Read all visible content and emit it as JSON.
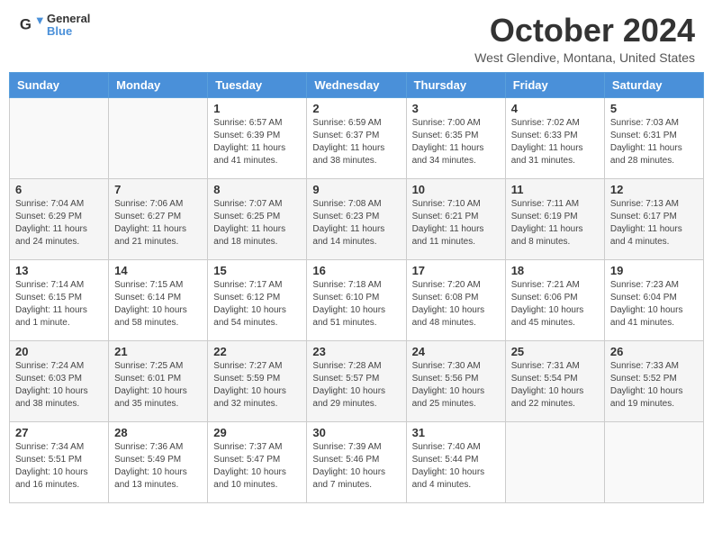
{
  "header": {
    "logo_line1": "General",
    "logo_line2": "Blue",
    "month_title": "October 2024",
    "subtitle": "West Glendive, Montana, United States"
  },
  "days_of_week": [
    "Sunday",
    "Monday",
    "Tuesday",
    "Wednesday",
    "Thursday",
    "Friday",
    "Saturday"
  ],
  "weeks": [
    [
      {
        "day": "",
        "info": ""
      },
      {
        "day": "",
        "info": ""
      },
      {
        "day": "1",
        "info": "Sunrise: 6:57 AM\nSunset: 6:39 PM\nDaylight: 11 hours and 41 minutes."
      },
      {
        "day": "2",
        "info": "Sunrise: 6:59 AM\nSunset: 6:37 PM\nDaylight: 11 hours and 38 minutes."
      },
      {
        "day": "3",
        "info": "Sunrise: 7:00 AM\nSunset: 6:35 PM\nDaylight: 11 hours and 34 minutes."
      },
      {
        "day": "4",
        "info": "Sunrise: 7:02 AM\nSunset: 6:33 PM\nDaylight: 11 hours and 31 minutes."
      },
      {
        "day": "5",
        "info": "Sunrise: 7:03 AM\nSunset: 6:31 PM\nDaylight: 11 hours and 28 minutes."
      }
    ],
    [
      {
        "day": "6",
        "info": "Sunrise: 7:04 AM\nSunset: 6:29 PM\nDaylight: 11 hours and 24 minutes."
      },
      {
        "day": "7",
        "info": "Sunrise: 7:06 AM\nSunset: 6:27 PM\nDaylight: 11 hours and 21 minutes."
      },
      {
        "day": "8",
        "info": "Sunrise: 7:07 AM\nSunset: 6:25 PM\nDaylight: 11 hours and 18 minutes."
      },
      {
        "day": "9",
        "info": "Sunrise: 7:08 AM\nSunset: 6:23 PM\nDaylight: 11 hours and 14 minutes."
      },
      {
        "day": "10",
        "info": "Sunrise: 7:10 AM\nSunset: 6:21 PM\nDaylight: 11 hours and 11 minutes."
      },
      {
        "day": "11",
        "info": "Sunrise: 7:11 AM\nSunset: 6:19 PM\nDaylight: 11 hours and 8 minutes."
      },
      {
        "day": "12",
        "info": "Sunrise: 7:13 AM\nSunset: 6:17 PM\nDaylight: 11 hours and 4 minutes."
      }
    ],
    [
      {
        "day": "13",
        "info": "Sunrise: 7:14 AM\nSunset: 6:15 PM\nDaylight: 11 hours and 1 minute."
      },
      {
        "day": "14",
        "info": "Sunrise: 7:15 AM\nSunset: 6:14 PM\nDaylight: 10 hours and 58 minutes."
      },
      {
        "day": "15",
        "info": "Sunrise: 7:17 AM\nSunset: 6:12 PM\nDaylight: 10 hours and 54 minutes."
      },
      {
        "day": "16",
        "info": "Sunrise: 7:18 AM\nSunset: 6:10 PM\nDaylight: 10 hours and 51 minutes."
      },
      {
        "day": "17",
        "info": "Sunrise: 7:20 AM\nSunset: 6:08 PM\nDaylight: 10 hours and 48 minutes."
      },
      {
        "day": "18",
        "info": "Sunrise: 7:21 AM\nSunset: 6:06 PM\nDaylight: 10 hours and 45 minutes."
      },
      {
        "day": "19",
        "info": "Sunrise: 7:23 AM\nSunset: 6:04 PM\nDaylight: 10 hours and 41 minutes."
      }
    ],
    [
      {
        "day": "20",
        "info": "Sunrise: 7:24 AM\nSunset: 6:03 PM\nDaylight: 10 hours and 38 minutes."
      },
      {
        "day": "21",
        "info": "Sunrise: 7:25 AM\nSunset: 6:01 PM\nDaylight: 10 hours and 35 minutes."
      },
      {
        "day": "22",
        "info": "Sunrise: 7:27 AM\nSunset: 5:59 PM\nDaylight: 10 hours and 32 minutes."
      },
      {
        "day": "23",
        "info": "Sunrise: 7:28 AM\nSunset: 5:57 PM\nDaylight: 10 hours and 29 minutes."
      },
      {
        "day": "24",
        "info": "Sunrise: 7:30 AM\nSunset: 5:56 PM\nDaylight: 10 hours and 25 minutes."
      },
      {
        "day": "25",
        "info": "Sunrise: 7:31 AM\nSunset: 5:54 PM\nDaylight: 10 hours and 22 minutes."
      },
      {
        "day": "26",
        "info": "Sunrise: 7:33 AM\nSunset: 5:52 PM\nDaylight: 10 hours and 19 minutes."
      }
    ],
    [
      {
        "day": "27",
        "info": "Sunrise: 7:34 AM\nSunset: 5:51 PM\nDaylight: 10 hours and 16 minutes."
      },
      {
        "day": "28",
        "info": "Sunrise: 7:36 AM\nSunset: 5:49 PM\nDaylight: 10 hours and 13 minutes."
      },
      {
        "day": "29",
        "info": "Sunrise: 7:37 AM\nSunset: 5:47 PM\nDaylight: 10 hours and 10 minutes."
      },
      {
        "day": "30",
        "info": "Sunrise: 7:39 AM\nSunset: 5:46 PM\nDaylight: 10 hours and 7 minutes."
      },
      {
        "day": "31",
        "info": "Sunrise: 7:40 AM\nSunset: 5:44 PM\nDaylight: 10 hours and 4 minutes."
      },
      {
        "day": "",
        "info": ""
      },
      {
        "day": "",
        "info": ""
      }
    ]
  ]
}
